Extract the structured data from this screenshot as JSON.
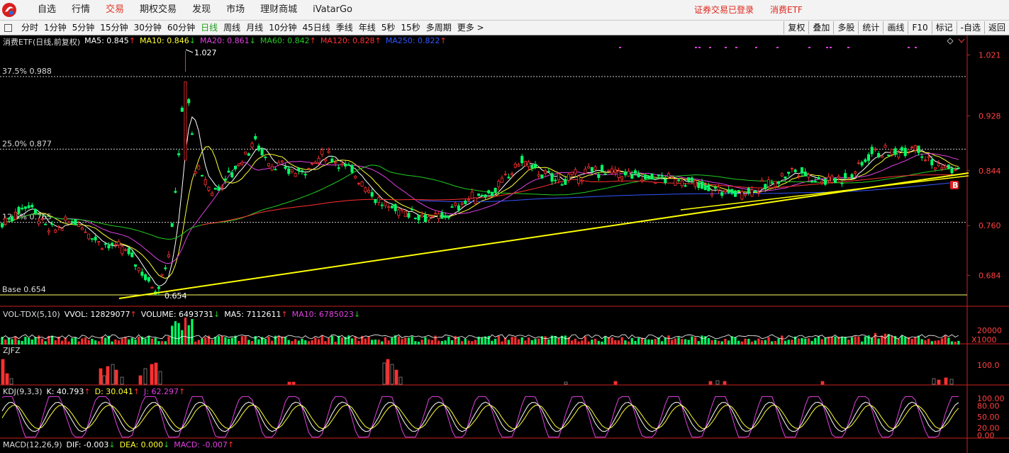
{
  "menu": [
    "自选",
    "行情",
    "交易",
    "期权交易",
    "发现",
    "市场",
    "理财商城",
    "iVatarGo"
  ],
  "status": {
    "login": "证券交易已登录",
    "security": "消费ETF"
  },
  "periods": [
    "分时",
    "1分钟",
    "5分钟",
    "15分钟",
    "30分钟",
    "60分钟",
    "日线",
    "周线",
    "月线",
    "10分钟",
    "45日线",
    "季线",
    "年线",
    "5秒",
    "15秒",
    "多周期",
    "更多 >"
  ],
  "tools": [
    "复权",
    "叠加",
    "多股",
    "统计",
    "画线",
    "F10",
    "标记",
    "-自选",
    "返回"
  ],
  "main": {
    "title": "消费ETF(日线,前复权)",
    "ma": [
      {
        "label": "MA5: 0.845",
        "arrow": "↑",
        "color": "#ffffff"
      },
      {
        "label": "MA10: 0.846",
        "arrow": "↓",
        "color": "#ffff33"
      },
      {
        "label": "MA20: 0.861",
        "arrow": "↓",
        "color": "#e040e0"
      },
      {
        "label": "MA60: 0.842",
        "arrow": "↑",
        "color": "#22cc22"
      },
      {
        "label": "MA120: 0.828",
        "arrow": "↑",
        "color": "#ff3030"
      },
      {
        "label": "MA250: 0.822",
        "arrow": "↑",
        "color": "#3355ff"
      }
    ],
    "y_ticks": [
      "1.021",
      "0.928",
      "0.844",
      "0.760",
      "0.684"
    ],
    "fib": [
      {
        "label": "37.5% 0.988",
        "price": 0.988
      },
      {
        "label": "25.0% 0.877",
        "price": 0.877
      },
      {
        "label": "12.5% 0.765",
        "price": 0.765
      },
      {
        "label": "Base 0.654",
        "price": 0.654
      }
    ],
    "high_label": "1.027",
    "low_label": "0.654",
    "b_marker": "B"
  },
  "vol": {
    "title": "VOL-TDX(5,10)",
    "items": [
      {
        "label": "VVOL: 12829077",
        "arrow": "↑",
        "color": "#ffffff"
      },
      {
        "label": "VOLUME: 6493731",
        "arrow": "↓",
        "color": "#ffffff"
      },
      {
        "label": "MA5: 7112611",
        "arrow": "↑",
        "color": "#ffffff"
      },
      {
        "label": "MA10: 6785023",
        "arrow": "↓",
        "color": "#e040e0"
      }
    ],
    "ticks": [
      "20000",
      "X1000"
    ]
  },
  "zjfz": {
    "title": "ZJFZ",
    "ticks": [
      "100.0"
    ]
  },
  "kdj": {
    "title": "KDJ(9,3,3)",
    "items": [
      {
        "label": "K: 40.793",
        "arrow": "↑",
        "color": "#ffffff"
      },
      {
        "label": "D: 30.041",
        "arrow": "↑",
        "color": "#ffff33"
      },
      {
        "label": "J: 62.297",
        "arrow": "↑",
        "color": "#e040e0"
      }
    ],
    "ticks": [
      "100.00",
      "80.00",
      "50.00",
      "20.00",
      "0.00"
    ]
  },
  "macd": {
    "title": "MACD(12,26,9)",
    "items": [
      {
        "label": "DIF: -0.003",
        "arrow": "↓",
        "color": "#ffffff"
      },
      {
        "label": "DEA: 0.000",
        "arrow": "↓",
        "color": "#ffff33"
      },
      {
        "label": "MACD: -0.007",
        "arrow": "↑",
        "color": "#e040e0"
      }
    ]
  },
  "colors": {
    "up": "#ff3030",
    "down": "#00ff66",
    "grid": "#7a0000",
    "axis": "#cc2020",
    "trend": "#ffff00"
  }
}
